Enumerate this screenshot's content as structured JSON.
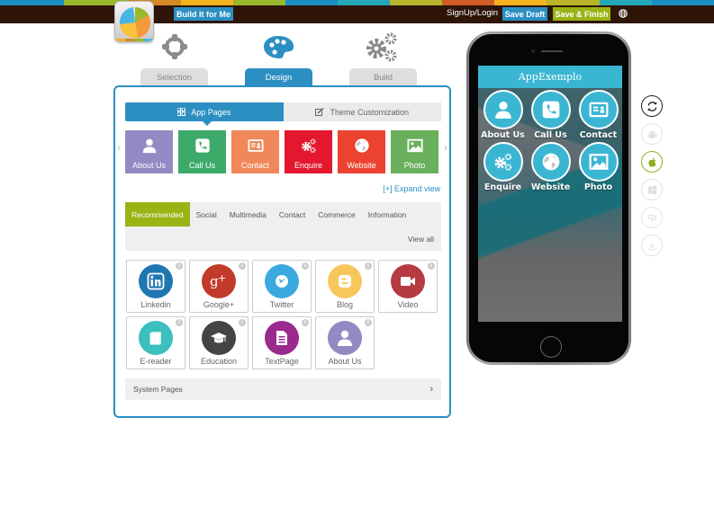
{
  "colors": {
    "primary": "#2b8fc2",
    "accent_green": "#9ab315",
    "topbar": "#2f1508",
    "app_teal": "#3ab6d2",
    "stripe": [
      "#1d8ec4",
      "#9ab82b",
      "#d58a23",
      "#f6b21d",
      "#9ab82b",
      "#1d8ec4",
      "#24a7b7",
      "#b8b52a",
      "#d05c26",
      "#f6b21d",
      "#b8b52a",
      "#24a7b7",
      "#1d8ec4"
    ]
  },
  "header": {
    "build_for_me": "Build It for Me",
    "signup_login": "SignUp/Login",
    "save_draft": "Save Draft",
    "save_finish": "Save & Finish",
    "language_icon": "globe-icon"
  },
  "steps": [
    {
      "label": "Selection",
      "icon": "crosshair-icon",
      "active": false
    },
    {
      "label": "Design",
      "icon": "palette-icon",
      "active": true
    },
    {
      "label": "Build",
      "icon": "gears-icon",
      "active": false
    }
  ],
  "subtabs": {
    "app_pages": "App Pages",
    "theme": "Theme Customization"
  },
  "pages": [
    {
      "label": "About Us",
      "color": "#9589c4",
      "icon": "person-icon"
    },
    {
      "label": "Call Us",
      "color": "#3daa6a",
      "icon": "phone-icon"
    },
    {
      "label": "Contact",
      "color": "#f0885a",
      "icon": "contact-card-icon"
    },
    {
      "label": "Enquire",
      "color": "#e3172d",
      "icon": "gears-icon"
    },
    {
      "label": "Website",
      "color": "#ec4330",
      "icon": "globe-icon"
    },
    {
      "label": "Photo",
      "color": "#6aaf5c",
      "icon": "image-icon"
    }
  ],
  "expand_view": "[+] Expand view",
  "categories": [
    "Recommended",
    "Social",
    "Multimedia",
    "Contact",
    "Commerce",
    "Information"
  ],
  "view_all": "View all",
  "features": [
    {
      "label": "Linkedin",
      "color": "#1f77b1",
      "icon": "linkedin-icon"
    },
    {
      "label": "Google+",
      "color": "#c23b2a",
      "icon": "google-plus-icon"
    },
    {
      "label": "Twitter",
      "color": "#3ba9e0",
      "icon": "twitter-icon"
    },
    {
      "label": "Blog",
      "color": "#f7c75d",
      "icon": "blogger-icon"
    },
    {
      "label": "Video",
      "color": "#b53a41",
      "icon": "video-camera-icon"
    },
    {
      "label": "E-reader",
      "color": "#3bbfbf",
      "icon": "book-icon"
    },
    {
      "label": "Education",
      "color": "#444444",
      "icon": "graduation-cap-icon"
    },
    {
      "label": "TextPage",
      "color": "#9a2a8e",
      "icon": "document-icon"
    },
    {
      "label": "About Us",
      "color": "#9589c4",
      "icon": "person-icon"
    }
  ],
  "system_pages": "System Pages",
  "preview": {
    "app_title": "AppExemplo",
    "items": [
      {
        "label": "About Us",
        "icon": "person-icon"
      },
      {
        "label": "Call Us",
        "icon": "phone-icon"
      },
      {
        "label": "Contact",
        "icon": "contact-card-icon"
      },
      {
        "label": "Enquire",
        "icon": "gears-icon"
      },
      {
        "label": "Website",
        "icon": "globe-icon"
      },
      {
        "label": "Photo",
        "icon": "image-icon"
      }
    ]
  },
  "platforms": [
    {
      "name": "refresh",
      "icon": "refresh-icon",
      "state": "refresh"
    },
    {
      "name": "android",
      "icon": "android-icon",
      "state": "disabled"
    },
    {
      "name": "ios",
      "icon": "apple-icon",
      "state": "active"
    },
    {
      "name": "windows",
      "icon": "windows-icon",
      "state": "disabled"
    },
    {
      "name": "blackberry",
      "icon": "blackberry-icon",
      "state": "disabled"
    },
    {
      "name": "amazon",
      "icon": "amazon-icon",
      "state": "disabled"
    }
  ]
}
